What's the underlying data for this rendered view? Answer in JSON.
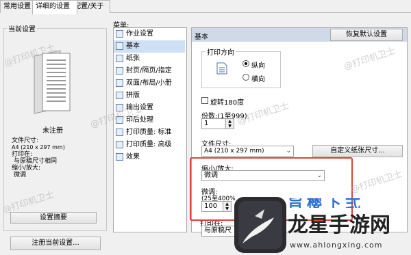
{
  "tabs": [
    {
      "label": "常用设置"
    },
    {
      "label": "详细的设置"
    },
    {
      "label": "配置/关于"
    }
  ],
  "left": {
    "group_title": "当前设置",
    "status": "未注册",
    "info": {
      "paper_size_label": "文件尺寸:",
      "paper_size_value": "A4 (210 x 297 mm)",
      "print_on_label": "打印在:",
      "print_on_value": "与原稿尺寸相同",
      "scale_label": "缩小/放大:",
      "scale_value": "微调"
    },
    "settings_summary_button": "设置摘要",
    "register_button": "注册当前设置..."
  },
  "menu": {
    "title": "菜单:",
    "items": [
      {
        "label": "作业设置"
      },
      {
        "label": "基本"
      },
      {
        "label": "纸张"
      },
      {
        "label": "封页/隔页/指定"
      },
      {
        "label": "双面/布局/小册"
      },
      {
        "label": "拼版"
      },
      {
        "label": "输出设置"
      },
      {
        "label": "印后处理"
      },
      {
        "label": "打印质量: 标准"
      },
      {
        "label": "打印质量: 高级"
      },
      {
        "label": "效果"
      }
    ],
    "selected_index": 1
  },
  "panel": {
    "title": "基本",
    "restore_button": "恢复默认设置",
    "orientation": {
      "title": "打印方向",
      "portrait": "纵向",
      "landscape": "横向",
      "selected": "portrait"
    },
    "rotate_label": "旋转180度",
    "copies": {
      "label": "份数:(1至999)",
      "value": "1"
    },
    "paper_size": {
      "label": "文件尺寸:",
      "value": "A4 (210 x 297 mm)"
    },
    "custom_size_button": "自定义纸张尺寸...",
    "scale": {
      "label": "缩小/放大:",
      "value": "微调"
    },
    "fine": {
      "label": "微调:",
      "range": "(25至400%",
      "value": "100"
    },
    "print_on": {
      "label": "打印在:",
      "value": "与原稿尺"
    }
  },
  "watermarks": {
    "text": "@打印机卫士",
    "brand_name": "龙星手游网",
    "brand_url": "www.ahlongxing.com",
    "brand_partial": "旨樱下弍"
  },
  "colors": {
    "highlight": "#e0423a",
    "selection": "#cfe0f5",
    "panel_header": "#cfd9e8"
  }
}
